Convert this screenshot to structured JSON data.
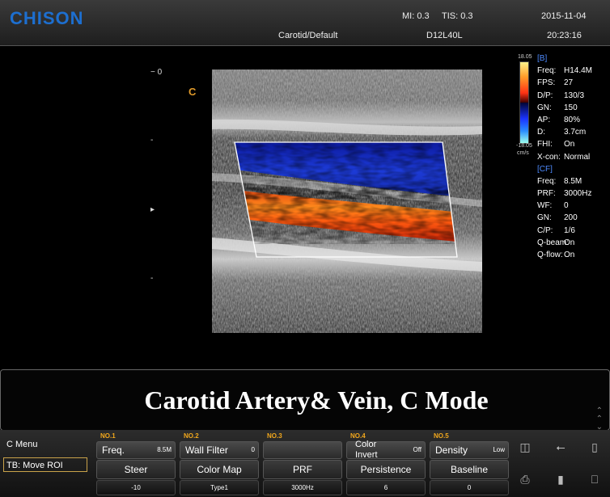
{
  "header": {
    "brand": "CHISON",
    "mi": "MI: 0.3",
    "tis": "TIS: 0.3",
    "date": "2015-11-04",
    "preset": "Carotid/Default",
    "probe": "D12L40L",
    "time": "20:23:16"
  },
  "image": {
    "depth_ticks": [
      "− 0",
      "-",
      "▸",
      "-"
    ],
    "mode_marker": "C"
  },
  "colorscale": {
    "top": "18.05",
    "bottom": "-18.05",
    "unit": "cm/s"
  },
  "params": {
    "b_header": "[B]",
    "b": [
      {
        "k": "Freq:",
        "v": "H14.4M"
      },
      {
        "k": "FPS:",
        "v": "27"
      },
      {
        "k": "D/P:",
        "v": "130/3"
      },
      {
        "k": "GN:",
        "v": "150"
      },
      {
        "k": "AP:",
        "v": "80%"
      },
      {
        "k": "D:",
        "v": "3.7cm"
      },
      {
        "k": "FHI:",
        "v": "On"
      },
      {
        "k": "X-con:",
        "v": "Normal"
      }
    ],
    "cf_header": "[CF]",
    "cf": [
      {
        "k": "Freq:",
        "v": "8.5M"
      },
      {
        "k": "PRF:",
        "v": "3000Hz"
      },
      {
        "k": "WF:",
        "v": "0"
      },
      {
        "k": "GN:",
        "v": "200"
      },
      {
        "k": "C/P:",
        "v": "1/6"
      },
      {
        "k": "Q-beam:",
        "v": "On"
      },
      {
        "k": "Q-flow:",
        "v": "On"
      }
    ]
  },
  "caption": "Carotid Artery& Vein, C Mode",
  "menu": {
    "title": "C Menu",
    "trackball": "TB: Move ROI",
    "knobs": [
      {
        "no": "NO.1",
        "top": "Freq.",
        "top_val": "8.5M",
        "mid": "Steer",
        "bot": "-10"
      },
      {
        "no": "NO.2",
        "top": "Wall Filter",
        "top_val": "0",
        "mid": "Color Map",
        "bot": "Type1"
      },
      {
        "no": "NO.3",
        "top": "",
        "top_val": "",
        "mid": "PRF",
        "bot": "3000Hz"
      },
      {
        "no": "NO.4",
        "top": "Color Invert",
        "top_val": "Off",
        "mid": "Persistence",
        "bot": "6"
      },
      {
        "no": "NO.5",
        "top": "Density",
        "top_val": "Low",
        "mid": "Baseline",
        "bot": "0"
      }
    ]
  },
  "icons": [
    "network-icon",
    "usb-icon",
    "storage-icon",
    "printer-icon",
    "battery-icon",
    "monitor-icon"
  ]
}
